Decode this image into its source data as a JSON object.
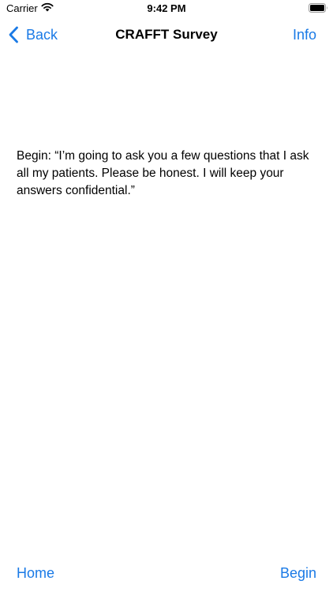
{
  "status_bar": {
    "carrier": "Carrier",
    "time": "9:42 PM",
    "icons": [
      "wifi-icon",
      "battery-icon"
    ]
  },
  "nav": {
    "back_label": "Back",
    "title": "CRAFFT Survey",
    "info_label": "Info",
    "icons": [
      "chevron-left-icon"
    ]
  },
  "content": {
    "intro": "Begin: “I’m going to ask you a few questions that I ask all my patients. Please be honest. I will keep your answers confidential.”"
  },
  "toolbar": {
    "home_label": "Home",
    "begin_label": "Begin"
  },
  "colors": {
    "accent": "#1a7ae6",
    "background": "#ffffff",
    "text": "#000000"
  }
}
